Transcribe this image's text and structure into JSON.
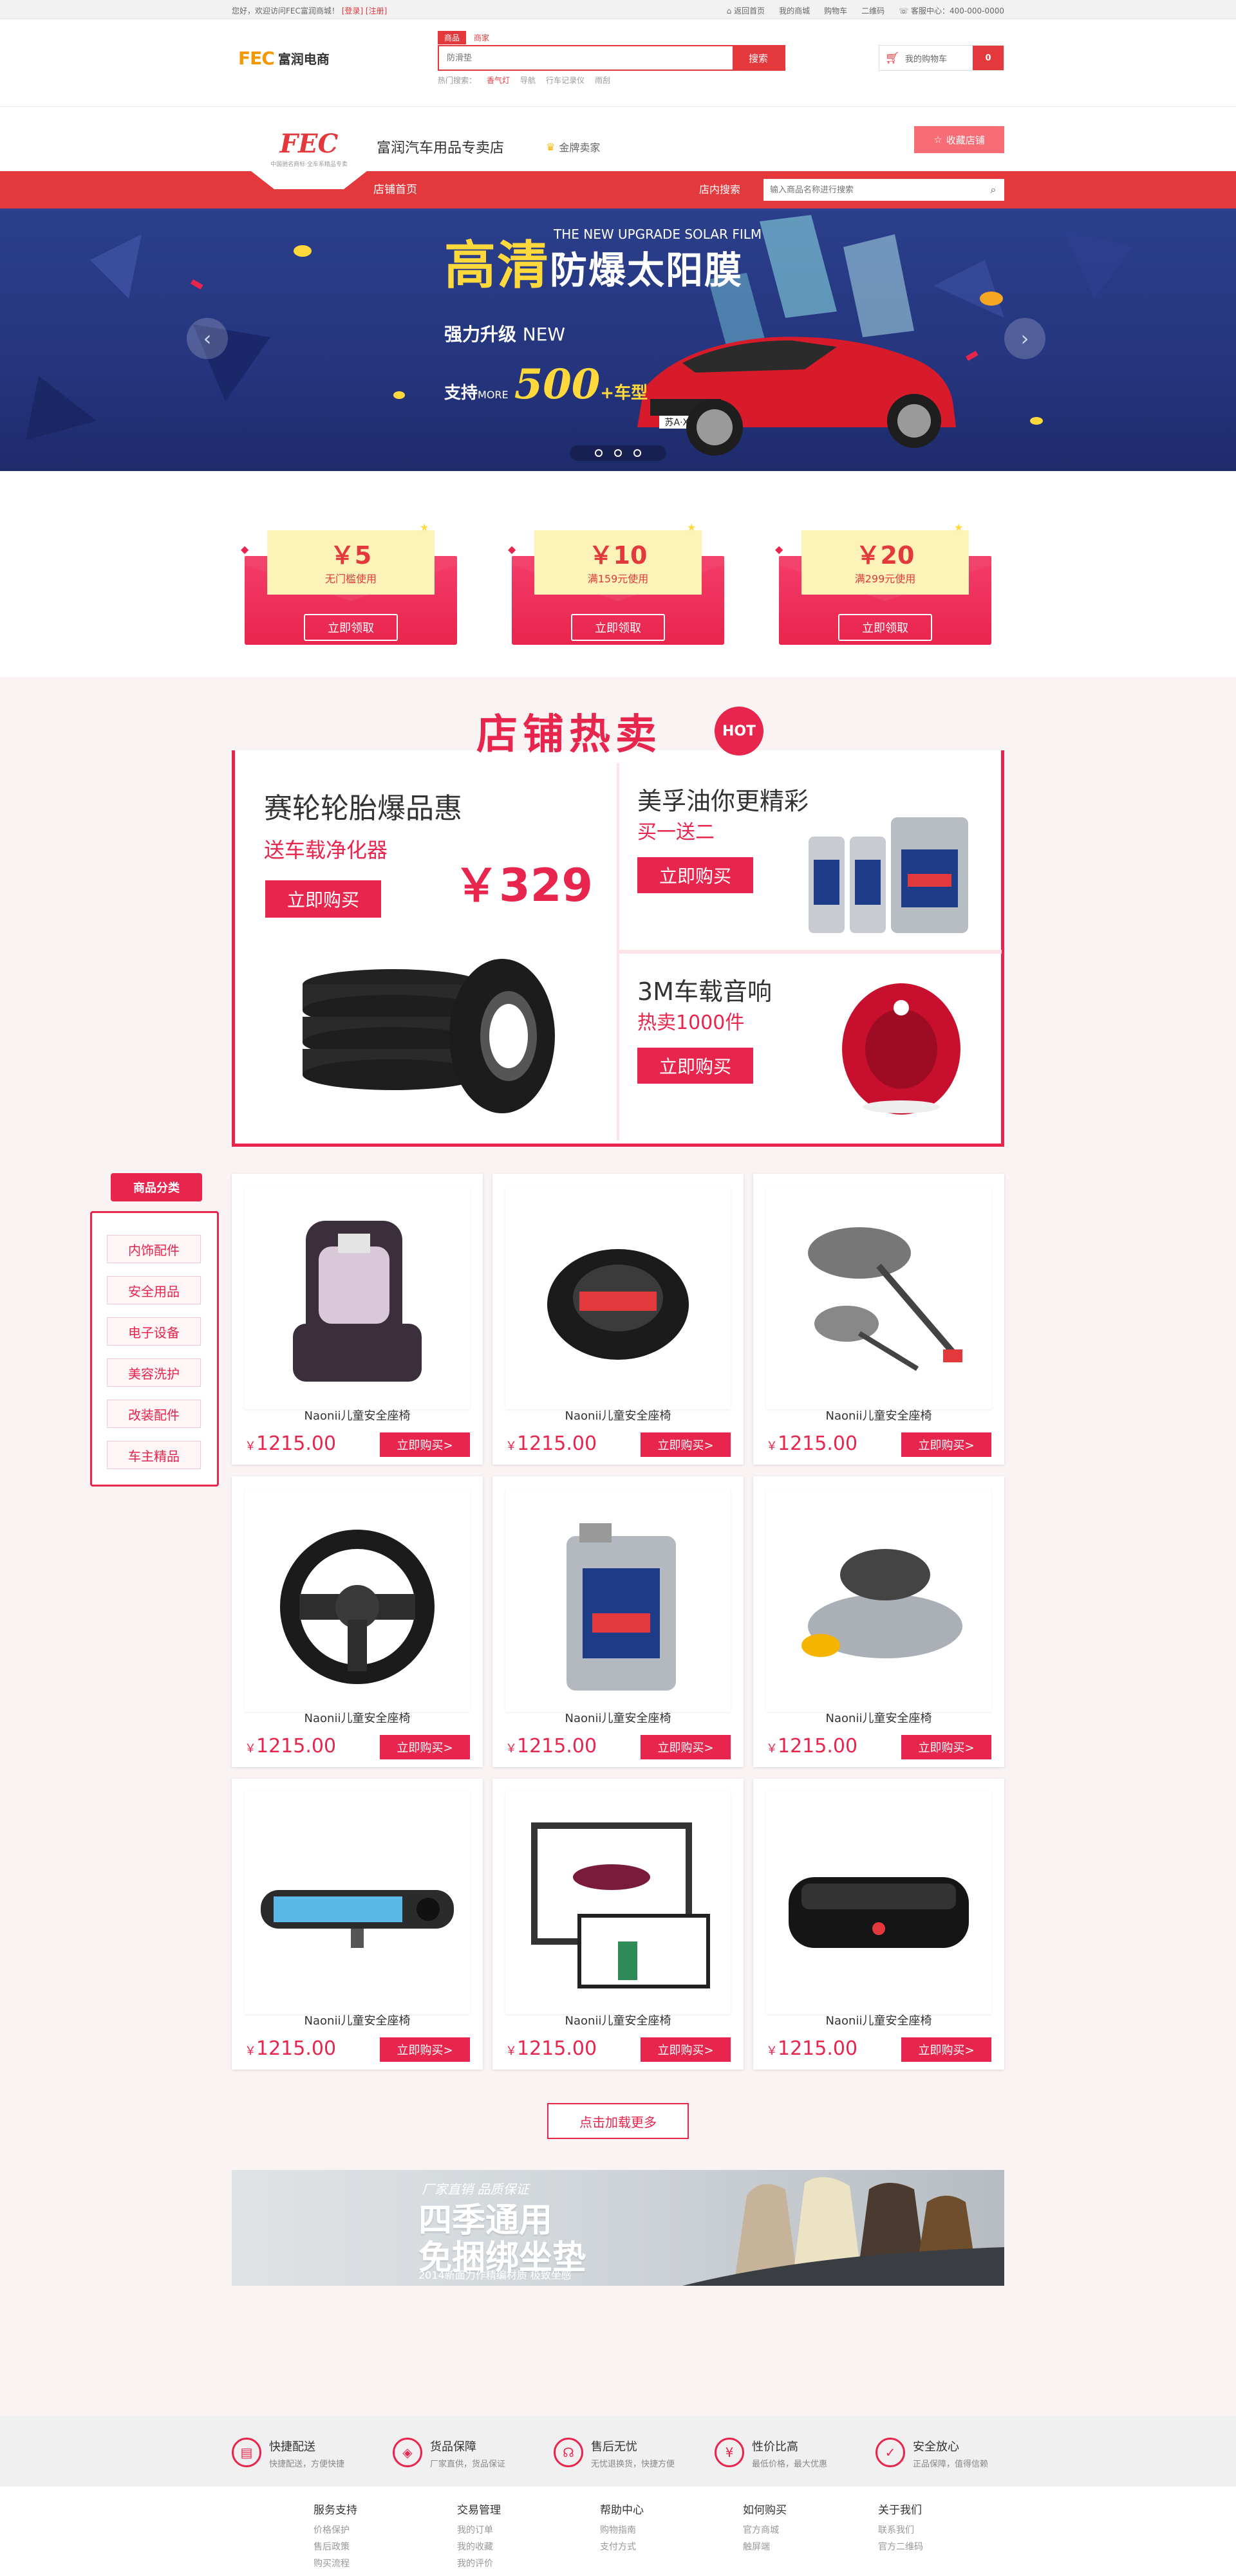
{
  "topbar": {
    "welcome": "您好，欢迎访问FEC富润商城！",
    "login": "[登录]",
    "register": "[注册]",
    "links": [
      "返回首页",
      "我的商城",
      "购物车",
      "二维码",
      "客服中心：400-000-0000"
    ]
  },
  "header": {
    "logo_mark": "FEC",
    "logo_name": "富润电商",
    "search_tabs": [
      "商品",
      "商家"
    ],
    "search_placeholder": "防滑垫",
    "search_button": "搜索",
    "hot_label": "热门搜索：",
    "hot_words": [
      "香气灯",
      "导航",
      "行车记录仪",
      "雨刮"
    ],
    "cart_label": "我的购物车",
    "cart_count": "0"
  },
  "shop": {
    "logo_mark": "FEC",
    "logo_sub": "中国驰名商标·全车系精品专卖",
    "name": "富润汽车用品专卖店",
    "badge": "金牌卖家",
    "fav_button": "收藏店铺",
    "nav_home": "店铺首页",
    "search_label": "店内搜索",
    "search_placeholder": "输入商品名称进行搜索"
  },
  "banner": {
    "title_en": "THE NEW UPGRADE SOLAR FILM",
    "title_a": "高清",
    "title_b": "防爆太阳膜",
    "line1_a": "强力升级",
    "line1_b": "NEW",
    "line2_a": "支持",
    "line2_more": "MORE",
    "line2_num": "500",
    "line2_plus": "+",
    "line2_b": "车型",
    "plate": "苏A·X3.M"
  },
  "coupons": [
    {
      "amount": "￥5",
      "cond": "无门槛使用",
      "btn": "立即领取"
    },
    {
      "amount": "￥10",
      "cond": "满159元使用",
      "btn": "立即领取"
    },
    {
      "amount": "￥20",
      "cond": "满299元使用",
      "btn": "立即领取"
    }
  ],
  "hot": {
    "title": "店铺热卖",
    "badge": "HOT",
    "main_title": "赛轮轮胎爆品惠",
    "main_sub": "送车载净化器",
    "main_price": "￥329",
    "buy": "立即购买",
    "r1_title": "美孚油你更精彩",
    "r1_sub": "买一送二",
    "r2_title": "3M车载音响",
    "r2_sub": "热卖1000件"
  },
  "categories": {
    "title": "商品分类",
    "items": [
      "内饰配件",
      "安全用品",
      "电子设备",
      "美容洗护",
      "改装配件",
      "车主精品"
    ]
  },
  "products": [
    {
      "name": "Naonii儿童安全座椅",
      "yen": "￥",
      "price": "1215.00",
      "btn": "立即购买>",
      "icon": "child-seat-icon"
    },
    {
      "name": "Naonii儿童安全座椅",
      "yen": "￥",
      "price": "1215.00",
      "btn": "立即购买>",
      "icon": "steering-cover-icon"
    },
    {
      "name": "Naonii儿童安全座椅",
      "yen": "￥",
      "price": "1215.00",
      "btn": "立即购买>",
      "icon": "car-duster-icon"
    },
    {
      "name": "Naonii儿童安全座椅",
      "yen": "￥",
      "price": "1215.00",
      "btn": "立即购买>",
      "icon": "steering-wheel-icon"
    },
    {
      "name": "Naonii儿童安全座椅",
      "yen": "￥",
      "price": "1215.00",
      "btn": "立即购买>",
      "icon": "oil-can-icon"
    },
    {
      "name": "Naonii儿童安全座椅",
      "yen": "￥",
      "price": "1215.00",
      "btn": "立即购买>",
      "icon": "car-perfume-icon"
    },
    {
      "name": "Naonii儿童安全座椅",
      "yen": "￥",
      "price": "1215.00",
      "btn": "立即购买>",
      "icon": "mirror-dashcam-icon"
    },
    {
      "name": "Naonii儿童安全座椅",
      "yen": "￥",
      "price": "1215.00",
      "btn": "立即购买>",
      "icon": "gift-box-icon"
    },
    {
      "name": "Naonii儿童安全座椅",
      "yen": "￥",
      "price": "1215.00",
      "btn": "立即购买>",
      "icon": "air-purifier-icon"
    }
  ],
  "load_more": "点击加载更多",
  "ad": {
    "l1": "厂家直销 品质保证",
    "l2": "四季通用",
    "l3": "免捆绑坐垫",
    "l4": "2014新面力作精编材质 极致坐感"
  },
  "services": [
    {
      "title": "快捷配送",
      "desc": "快捷配送，方便快捷",
      "icon": "truck-icon"
    },
    {
      "title": "货品保障",
      "desc": "厂家直供，货品保证",
      "icon": "tag-icon"
    },
    {
      "title": "售后无忧",
      "desc": "无忧退换货，快捷方便",
      "icon": "headset-icon"
    },
    {
      "title": "性价比高",
      "desc": "最低价格，最大优惠",
      "icon": "yen-icon"
    },
    {
      "title": "安全放心",
      "desc": "正品保障，值得信赖",
      "icon": "shield-icon"
    }
  ],
  "footer": [
    {
      "head": "服务支持",
      "items": [
        "价格保护",
        "售后政策",
        "购买流程"
      ]
    },
    {
      "head": "交易管理",
      "items": [
        "我的订单",
        "我的收藏",
        "我的评价"
      ]
    },
    {
      "head": "帮助中心",
      "items": [
        "购物指南",
        "支付方式"
      ]
    },
    {
      "head": "如何购买",
      "items": [
        "官方商城",
        "触屏端"
      ]
    },
    {
      "head": "关于我们",
      "items": [
        "联系我们",
        "官方二维码"
      ]
    }
  ],
  "colors": {
    "brand_red": "#e4393c",
    "hot_red": "#e8254d",
    "banner_blue": "#25357e",
    "coupon_yellow": "#fdf2b7"
  }
}
